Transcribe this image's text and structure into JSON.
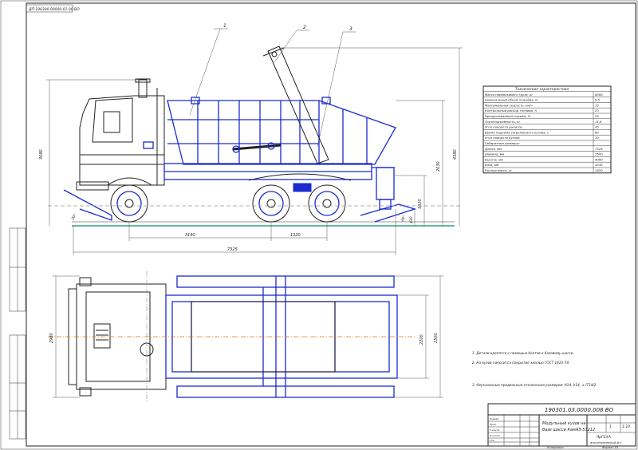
{
  "stamp_top": "ДП 190300.00000.01.00.ВО",
  "callouts": [
    "1",
    "2",
    "3"
  ],
  "dims": {
    "overall_length": "7325",
    "wheelbase": "3190",
    "rear_spacing": "1320",
    "cab_height": "3080",
    "arm_height": "4380",
    "body_height": "2030",
    "frame_height": "1020",
    "ground_clear": "430",
    "angle_front": "20°",
    "angle_rear": "26°",
    "plan_width": "2500",
    "body_width": "2200",
    "plan_overall": "2980"
  },
  "spec_table": {
    "title": "Технические характеристики",
    "rows": [
      [
        "Масса перевозимого груза, кг",
        "8000"
      ],
      [
        "Номинальный объём подъёма, м",
        "9,5"
      ],
      [
        "Максимальная скорость, км/ч",
        "75"
      ],
      [
        "Контрольный расход топлива, л",
        "23"
      ],
      [
        "Преодолеваемый подъём, %",
        "25"
      ],
      [
        "Грузоподъёмность, кг",
        "11,6"
      ],
      [
        "Угол поворота рычагов",
        "45"
      ],
      [
        "Время подъёма загруженного кузова, с",
        "60"
      ],
      [
        "Угол поворота кузова",
        "10"
      ],
      [
        "Габаритные размеры:",
        ""
      ],
      [
        "Длина, мм",
        "7325"
      ],
      [
        "Ширина, мм",
        "2500"
      ],
      [
        "Высота, мм",
        "4060"
      ],
      [
        "База, мм",
        "4330"
      ],
      [
        "Полная масса, кг",
        "1850"
      ]
    ]
  },
  "notes": [
    "1. Детали крепятся с помощью болтов к базовому шасси.",
    "2. На кузов наносится покрытие эмалью ГОСТ 1423-74.",
    "3. Неуказанные предельные отклонения размеров: H14, h14, ± IT14/2"
  ],
  "title_block": {
    "doc_number": "190301.03.0000.008 ВО",
    "title": "Модульный кузов на базе шасси КамАЗ-53212",
    "sheet": "1",
    "scale": "1:10",
    "org": "ЯрГСХА",
    "group": "агроинженерный ф-т",
    "roles": [
      "Разраб.",
      "Пров.",
      "Т.контр.",
      "Н.контр.",
      "Утв."
    ]
  },
  "bottom_labels": {
    "copied": "Копировал",
    "format": "Формат A1"
  }
}
